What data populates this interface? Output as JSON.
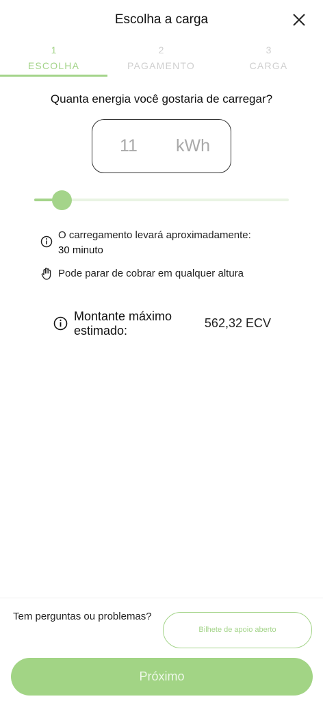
{
  "header": {
    "title": "Escolha a carga"
  },
  "steps": [
    {
      "num": "1",
      "label": "ESCOLHA",
      "active": true
    },
    {
      "num": "2",
      "label": "PAGAMENTO",
      "active": false
    },
    {
      "num": "3",
      "label": "CARGA",
      "active": false
    }
  ],
  "question": "Quanta energia você gostaria de carregar?",
  "energy": {
    "value": "11",
    "unit": "kWh"
  },
  "slider": {
    "fraction": 0.11
  },
  "info": {
    "duration_label": "O carregamento levará aproximadamente:",
    "duration_value": "30 minuto",
    "stop_note": "Pode parar de cobrar em qualquer altura"
  },
  "estimate": {
    "label": "Montante máximo estimado:",
    "value": "562,32 ECV"
  },
  "footer": {
    "questions": "Tem perguntas ou problemas?",
    "ticket_button": "Bilhete de apoio aberto",
    "next_button": "Próximo"
  },
  "colors": {
    "accent": "#a4d48a",
    "track": "#e9f4e3",
    "inactive": "#cfcfcf"
  },
  "icons": {
    "close": "close-icon",
    "info": "info-icon",
    "hand": "hand-icon"
  }
}
